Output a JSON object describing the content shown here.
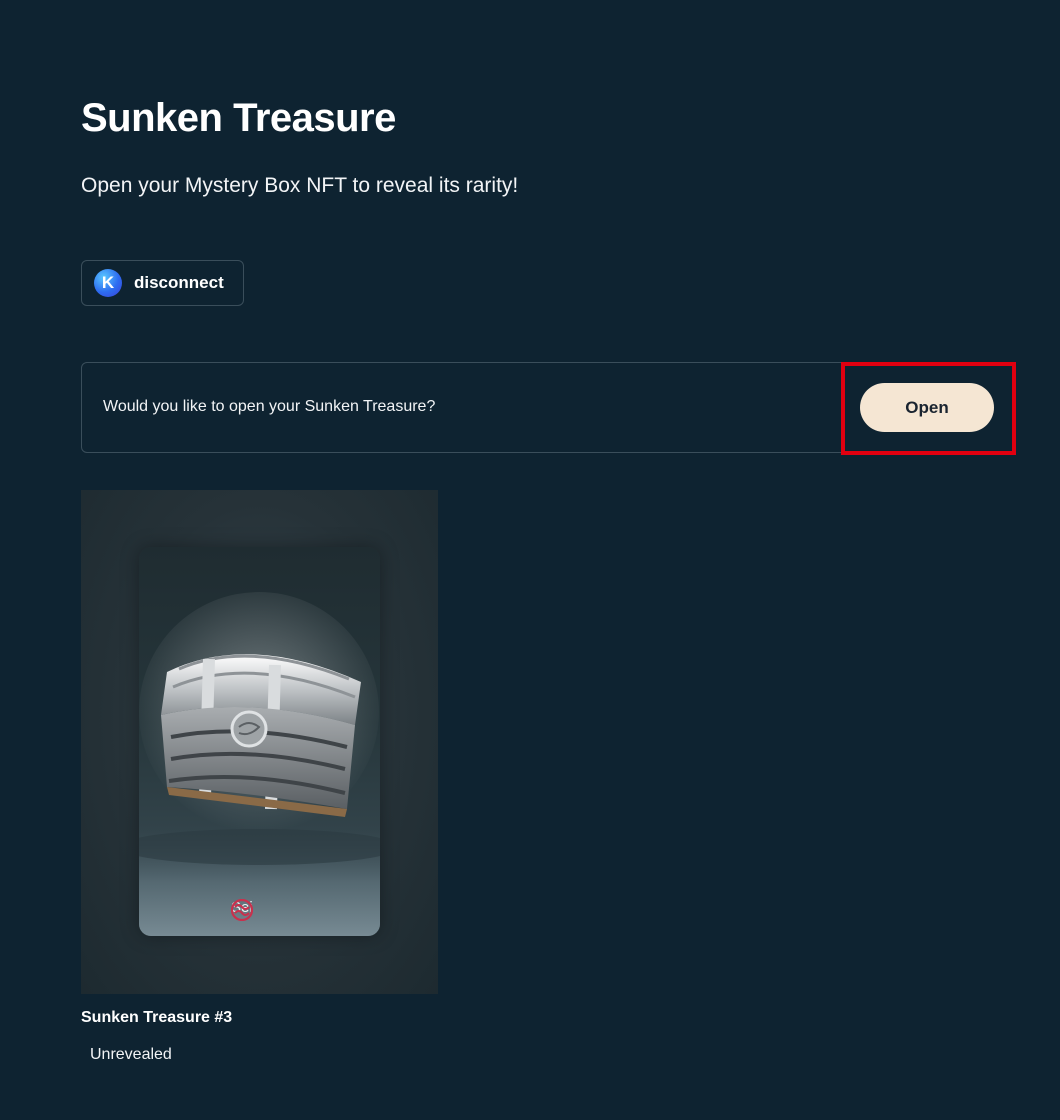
{
  "page": {
    "title": "Sunken Treasure",
    "subtitle": "Open your Mystery Box NFT to reveal its rarity!"
  },
  "wallet": {
    "logo_letter": "K",
    "action_label": "disconnect"
  },
  "open_prompt": {
    "question": "Would you like to open your Sunken Treasure?",
    "button_label": "Open"
  },
  "nft": {
    "image_icon": "treasure-chest-image",
    "badge_icon": "sei-logo-icon",
    "badge_label": "Sei",
    "name": "Sunken Treasure #3",
    "status": "Unrevealed"
  },
  "colors": {
    "background": "#0e2331",
    "open_button": "#f5e6d3",
    "highlight": "#e10010",
    "sei_brand": "#c8314d"
  }
}
